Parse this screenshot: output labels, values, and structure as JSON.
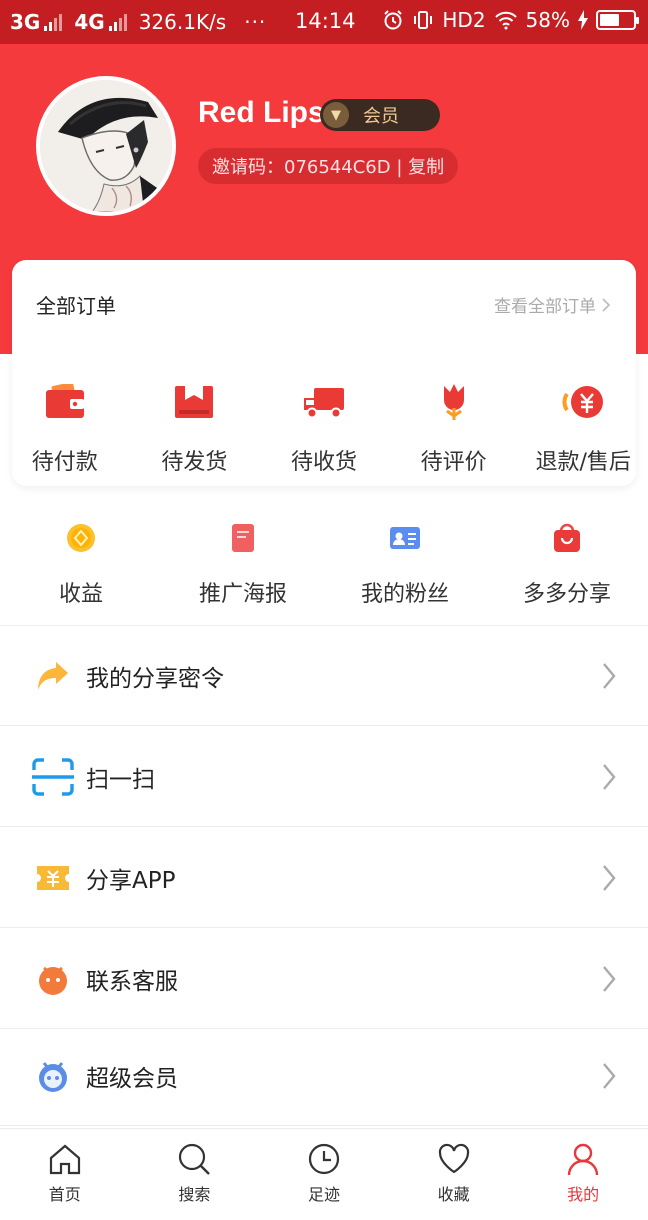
{
  "status_bar": {
    "net1": "3G",
    "net2": "4G",
    "speed": "326.1K/s",
    "dots": "···",
    "time": "14:14",
    "hd": "HD2",
    "battery": "58%",
    "battery_level": 0.58
  },
  "profile": {
    "username": "Red Lips",
    "badge_icon": "▼",
    "badge_label": "会员",
    "invite_text": "邀请码：076544C6D | 复制"
  },
  "orders": {
    "title": "全部订单",
    "view_all": "查看全部订单",
    "items": [
      {
        "label": "待付款",
        "icon": "wallet-icon"
      },
      {
        "label": "待发货",
        "icon": "package-icon"
      },
      {
        "label": "待收货",
        "icon": "truck-icon"
      },
      {
        "label": "待评价",
        "icon": "flower-icon"
      },
      {
        "label": "退款/售后",
        "icon": "refund-icon"
      }
    ]
  },
  "tools": [
    {
      "label": "收益",
      "icon": "coin-icon"
    },
    {
      "label": "推广海报",
      "icon": "poster-icon"
    },
    {
      "label": "我的粉丝",
      "icon": "id-card-icon"
    },
    {
      "label": "多多分享",
      "icon": "gift-bag-icon"
    }
  ],
  "menu": [
    {
      "label": "我的分享密令",
      "icon": "share-arrow-icon"
    },
    {
      "label": "扫一扫",
      "icon": "scan-icon"
    },
    {
      "label": "分享APP",
      "icon": "ticket-icon"
    },
    {
      "label": "联系客服",
      "icon": "service-icon"
    },
    {
      "label": "超级会员",
      "icon": "robot-icon"
    }
  ],
  "nav": [
    {
      "label": "首页",
      "icon": "home-icon"
    },
    {
      "label": "搜索",
      "icon": "search-icon"
    },
    {
      "label": "足迹",
      "icon": "clock-icon"
    },
    {
      "label": "收藏",
      "icon": "heart-icon"
    },
    {
      "label": "我的",
      "icon": "user-icon"
    }
  ],
  "colors": {
    "header": "#f43a3d",
    "status_bar": "#c41e22",
    "accent": "#e8383b",
    "vip_badge": "#3a2a22",
    "vip_text": "#f1c893"
  }
}
